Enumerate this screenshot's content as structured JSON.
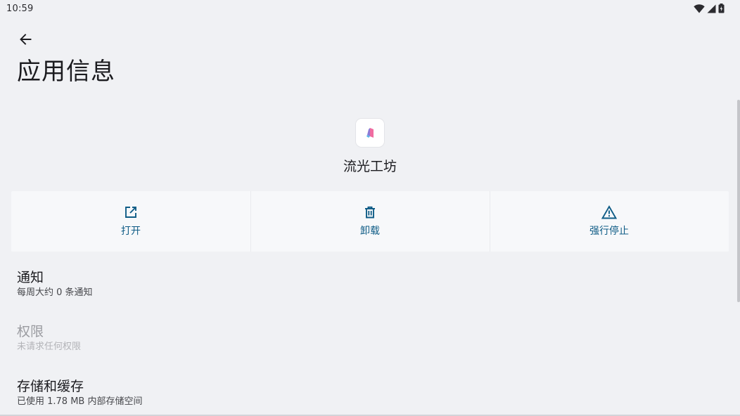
{
  "status_bar": {
    "time": "10:59",
    "icons": [
      "wifi-icon",
      "cell-signal-icon",
      "battery-icon"
    ]
  },
  "header": {
    "back_icon": "arrow-back-icon",
    "title": "应用信息"
  },
  "app": {
    "name": "流光工坊",
    "icon": "app-logo-icon"
  },
  "actions": [
    {
      "label": "打开",
      "icon": "open-external-icon"
    },
    {
      "label": "卸载",
      "icon": "trash-icon"
    },
    {
      "label": "强行停止",
      "icon": "warning-icon"
    }
  ],
  "prefs": [
    {
      "title": "通知",
      "summary": "每周大约 0 条通知",
      "enabled": true
    },
    {
      "title": "权限",
      "summary": "未请求任何权限",
      "enabled": false
    },
    {
      "title": "存储和缓存",
      "summary": "已使用 1.78 MB 内部存储空间",
      "enabled": true
    }
  ],
  "colors": {
    "accent": "#0f5c86",
    "background": "#f0f1f4",
    "action_bar": "#f7f8fa"
  }
}
